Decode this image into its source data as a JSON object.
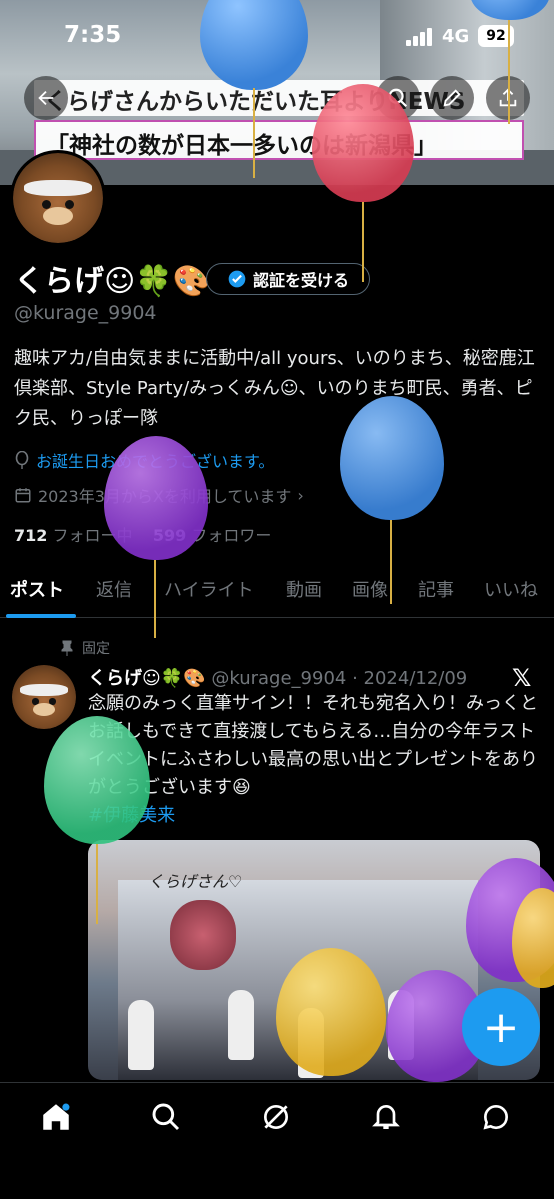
{
  "status_bar": {
    "time": "7:35",
    "network": "4G",
    "battery": "92"
  },
  "banner": {
    "caption_line1": "くらげさんからいただいた耳よりNEWS",
    "caption_line2": "「神社の数が日本一多いのは新潟県」"
  },
  "profile": {
    "name": "くらげ☺🍀🎨",
    "verify_label": "認証を受ける",
    "handle": "@kurage_9904",
    "bio": "趣味アカ/自由気ままに活動中/all yours、いのりまち、秘密鹿江倶楽部、Style Party/みっくみん☺、いのりまち町民、勇者、ピク民、りっぽー隊",
    "birthday": "お誕生日おめでとうございます。",
    "joined": "2023年3月からXを利用しています",
    "following_count": "712",
    "following_label": "フォロー中",
    "followers_count": "599",
    "followers_label": "フォロワー"
  },
  "tabs": [
    {
      "label": "ポスト"
    },
    {
      "label": "返信"
    },
    {
      "label": "ハイライト"
    },
    {
      "label": "動画"
    },
    {
      "label": "画像"
    },
    {
      "label": "記事"
    },
    {
      "label": "いいね"
    }
  ],
  "pinned_post": {
    "pinned_label": "固定",
    "author": "くらげ☺🍀🎨",
    "handle_date": "@kurage_9904 · 2024/12/09",
    "text": "念願のみっく直筆サイン！！それも宛名入り！みっくとお話しもできて直接渡してもらえる…自分の今年ラストイベントにふさわしい最高の思い出とプレゼントをありがとうございます😆",
    "hashtag": "#伊藤美来",
    "photo_signature": "くらげさん♡"
  },
  "colors": {
    "accent": "#1d9bf0",
    "background": "#000000",
    "muted": "#71767b"
  },
  "icons": [
    "back-arrow-icon",
    "search-icon",
    "edit-icon",
    "share-icon",
    "verified-badge-icon",
    "balloon-icon",
    "calendar-icon",
    "pin-icon",
    "x-logo-icon",
    "home-icon",
    "search-icon",
    "grok-icon",
    "bell-icon",
    "messages-icon",
    "compose-plus-icon"
  ]
}
